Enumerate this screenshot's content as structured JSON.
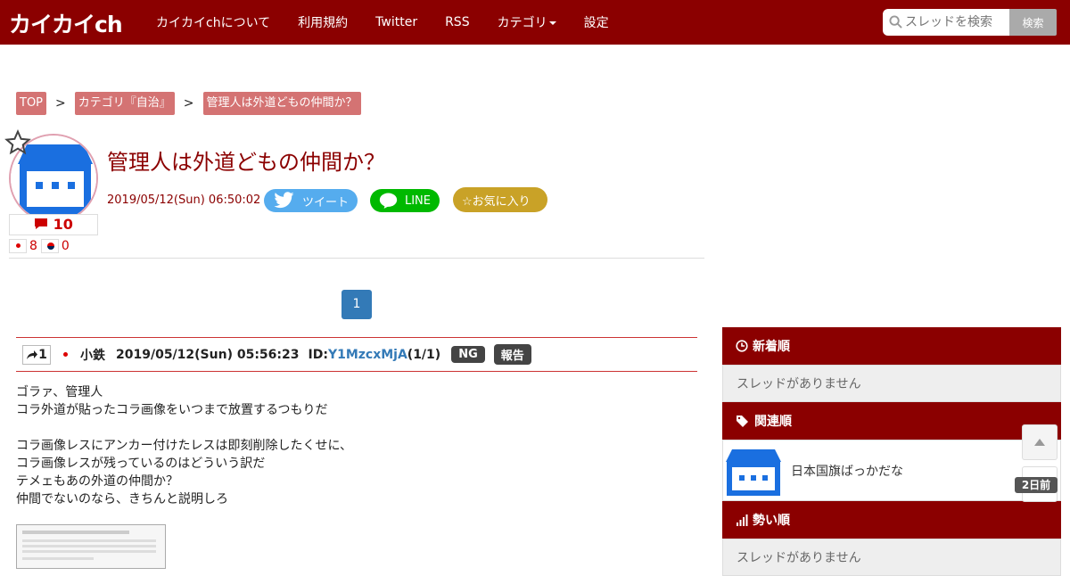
{
  "header": {
    "logo": "カイカイch",
    "nav": [
      "カイカイchについて",
      "利用規約",
      "Twitter",
      "RSS",
      "カテゴリ",
      "設定"
    ],
    "search_placeholder": "スレッドを検索",
    "search_button": "検索"
  },
  "breadcrumb": [
    "TOP",
    "カテゴリ『自治』",
    "管理人は外道どもの仲間か？"
  ],
  "breadcrumb_sep": ">",
  "thread": {
    "title": "管理人は外道どもの仲間か？",
    "date": "2019/05/12(Sun) 06:50:02",
    "reply_count": "10",
    "jp_count": "8",
    "kr_count": "0",
    "tweet_label": "ツイート",
    "line_label": "LINE",
    "fav_label": "☆お気に入り"
  },
  "pagination": [
    "1"
  ],
  "post": {
    "number": "1",
    "name": "小鉄",
    "date": "2019/05/12(Sun) 05:56:23",
    "id_label": "ID:",
    "id": "Y1MzcxMjA",
    "id_count": "(1/1)",
    "ng_label": "NG",
    "report_label": "報告",
    "body": "ゴラァ、管理人\nコラ外道が貼ったコラ画像をいつまで放置するつもりだ\n\nコラ画像レスにアンカー付けたレスは即刻削除したくせに、\nコラ画像レスが残っているのはどういう訳だ\nテメェもあの外道の仲間か？\n仲間でないのなら、きちんと説明しろ"
  },
  "sidebar": {
    "new_heading": "新着順",
    "new_empty": "スレッドがありません",
    "related_heading": "関連順",
    "related_items": [
      "日本国旗ばっかだな"
    ],
    "hot_heading": "勢い順",
    "hot_empty": "スレッドがありません"
  },
  "page_badge": "2日前",
  "colors": {
    "brand": "#8b0000",
    "crumb": "#d47373",
    "link": "#337ab7"
  }
}
